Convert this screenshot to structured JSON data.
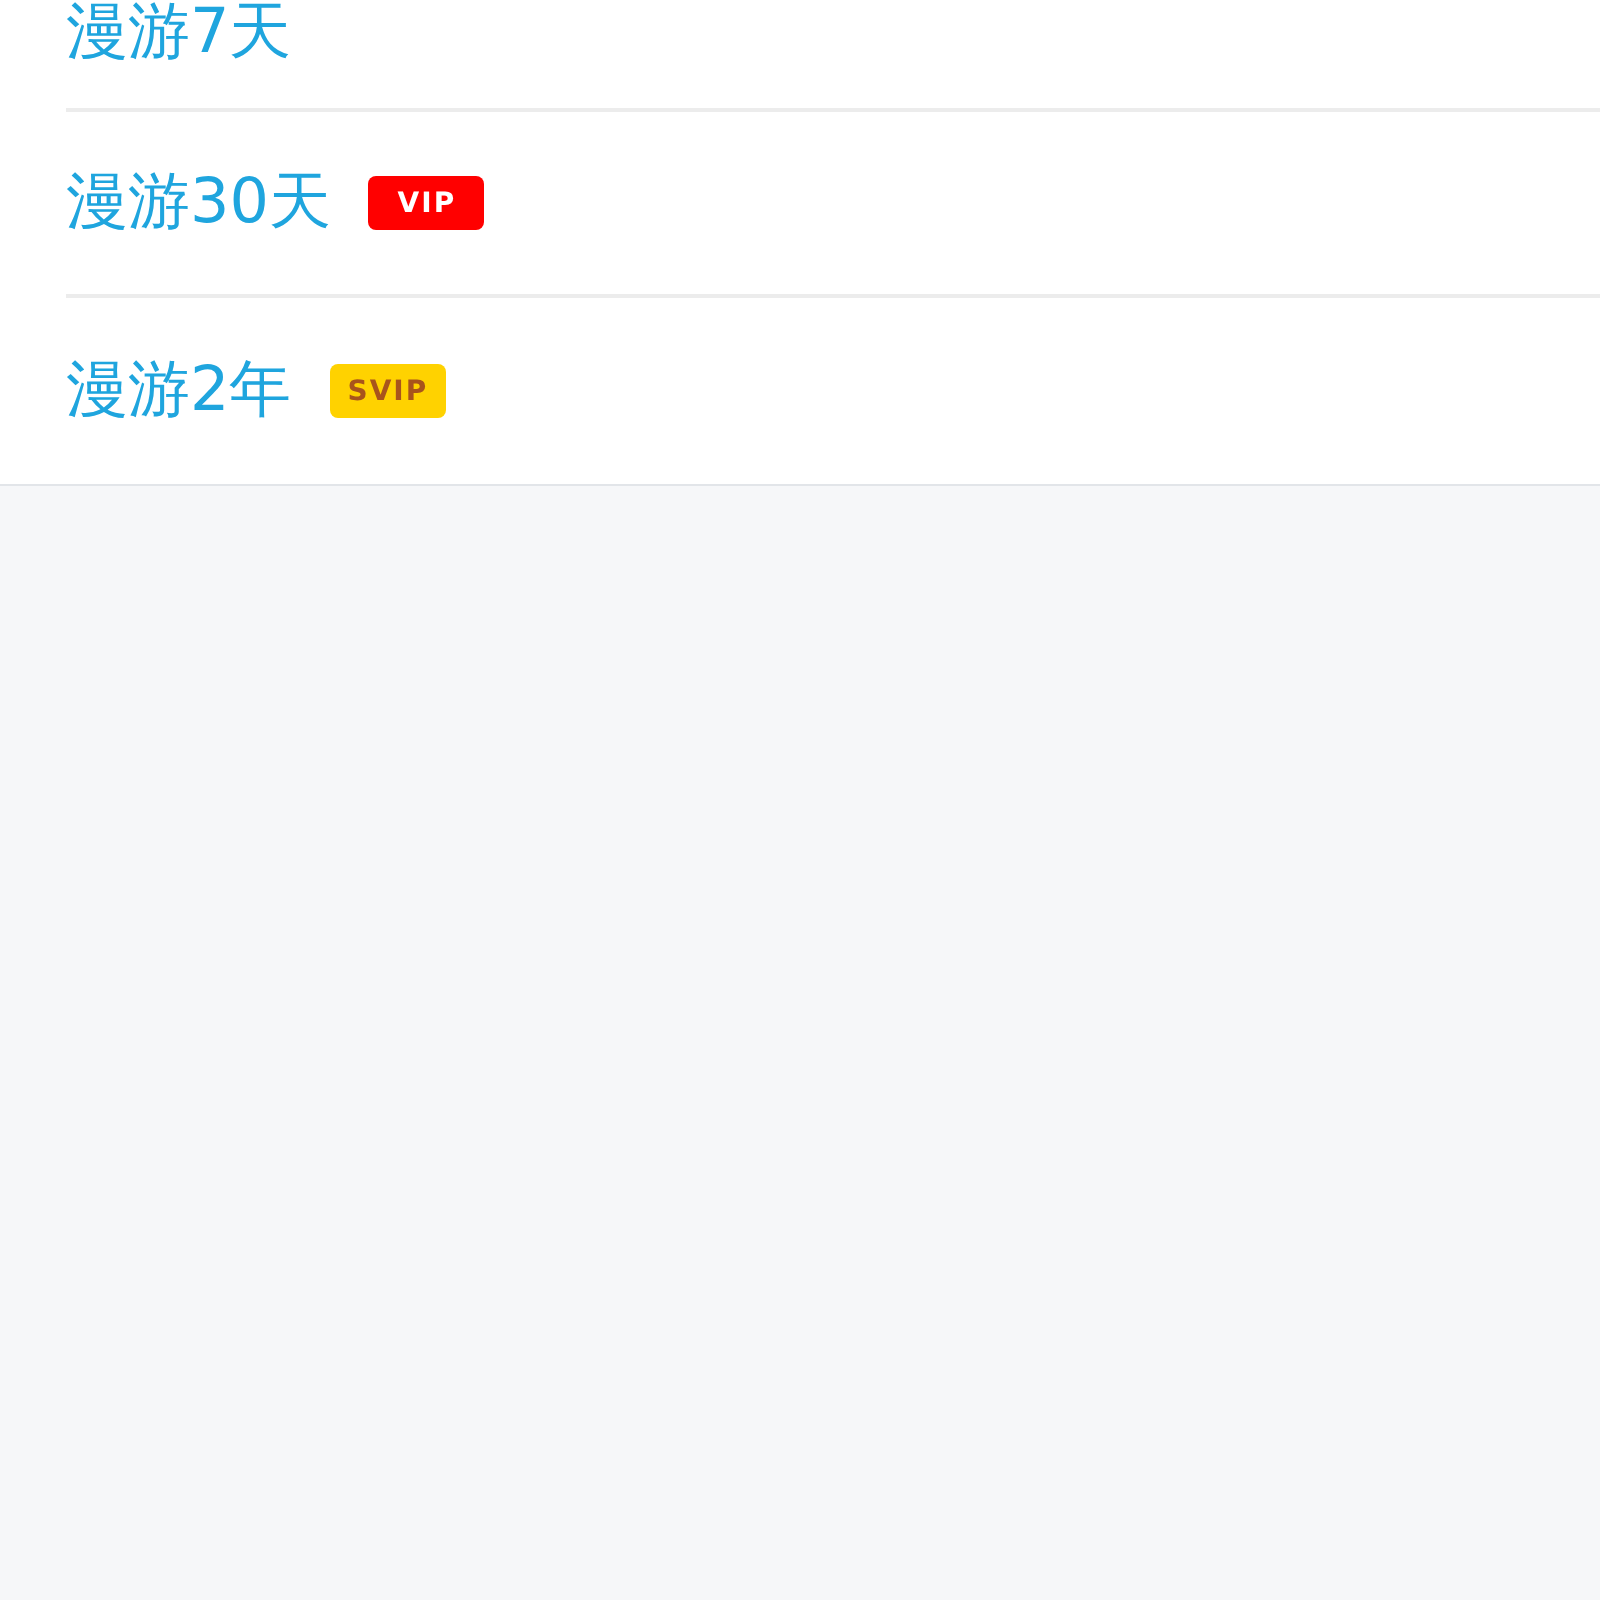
{
  "list": {
    "items": [
      {
        "label": "漫游7天"
      },
      {
        "label": "漫游30天",
        "badge": {
          "kind": "vip",
          "text": "VIP"
        }
      },
      {
        "label": "漫游2年",
        "badge": {
          "kind": "svip",
          "text": "SVIP"
        }
      }
    ]
  }
}
